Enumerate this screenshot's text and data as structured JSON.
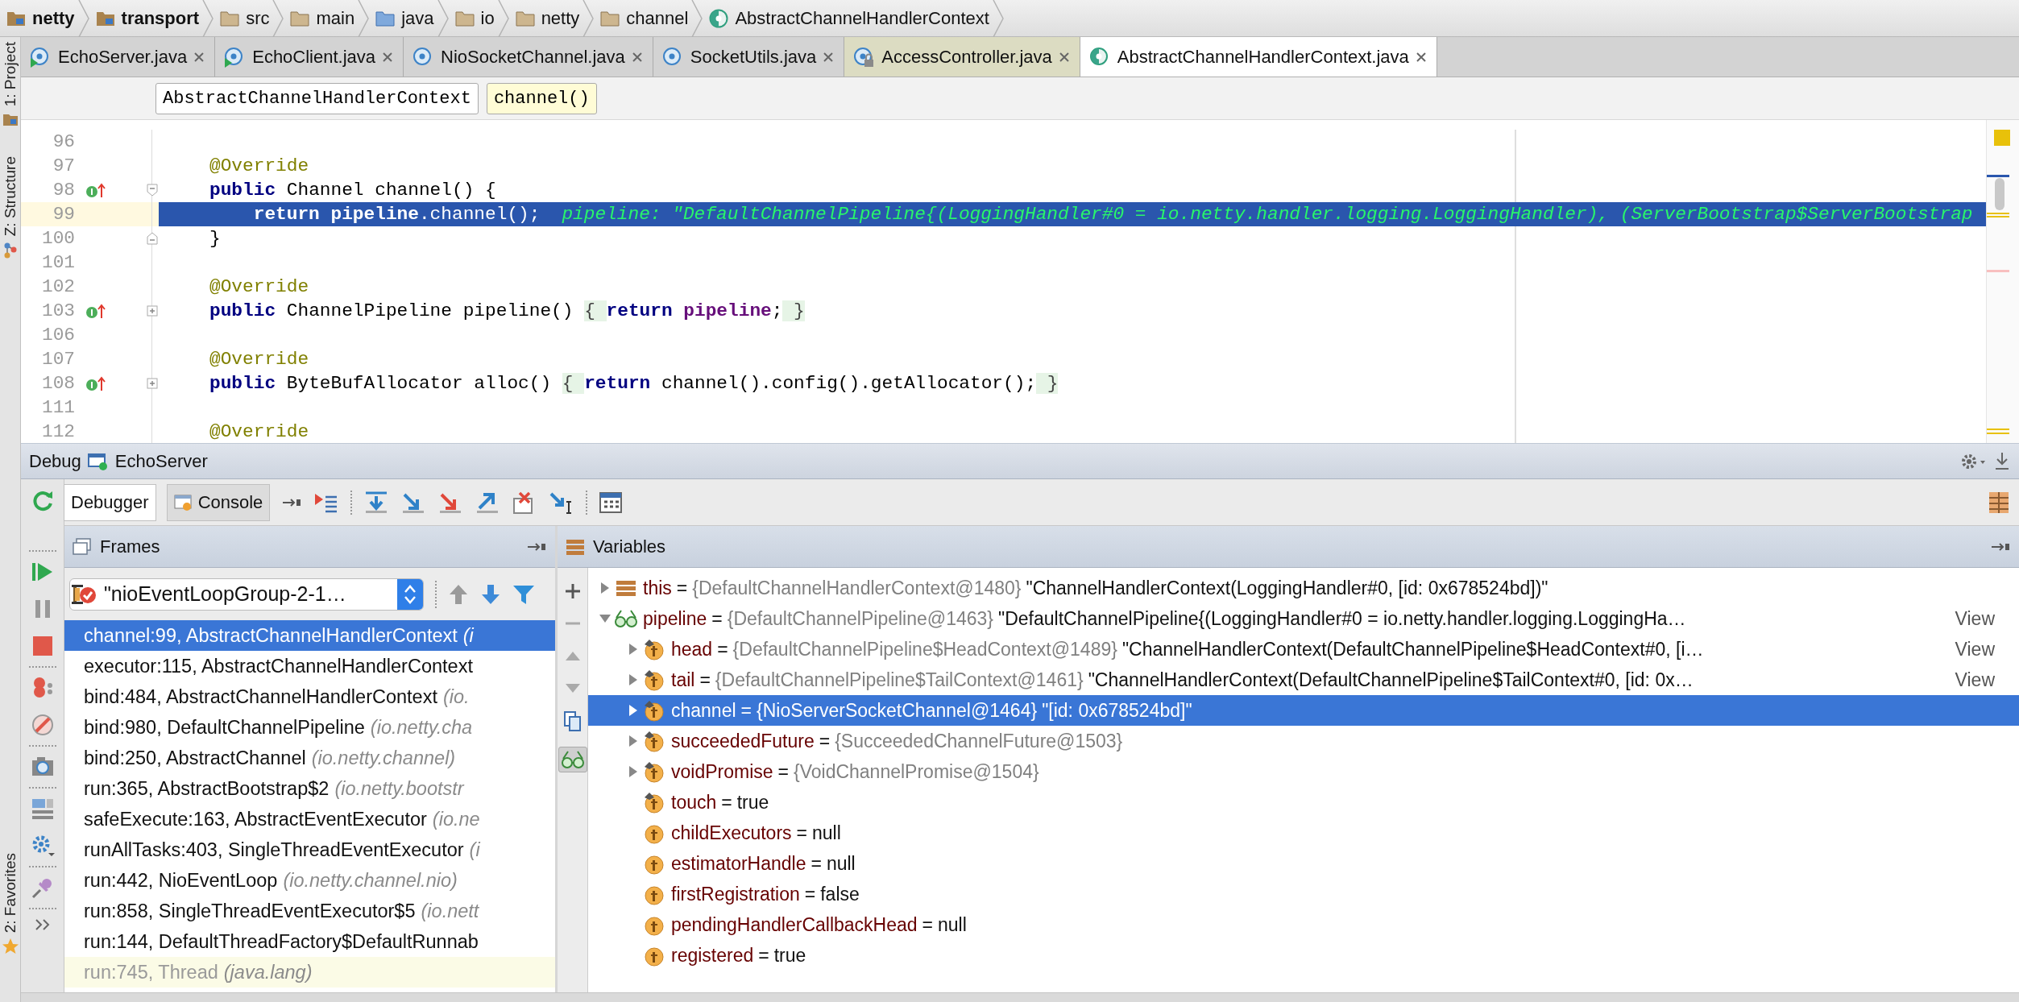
{
  "breadcrumbs": [
    {
      "label": "netty",
      "kind": "module"
    },
    {
      "label": "transport",
      "kind": "module"
    },
    {
      "label": "src",
      "kind": "folder"
    },
    {
      "label": "main",
      "kind": "folder"
    },
    {
      "label": "java",
      "kind": "source"
    },
    {
      "label": "io",
      "kind": "folder"
    },
    {
      "label": "netty",
      "kind": "folder"
    },
    {
      "label": "channel",
      "kind": "folder"
    },
    {
      "label": "AbstractChannelHandlerContext",
      "kind": "class"
    }
  ],
  "tool_windows": [
    {
      "label": "1: Project",
      "kind": "project"
    },
    {
      "label": "Z: Structure",
      "kind": "structure"
    },
    {
      "label": "2: Favorites",
      "kind": "favorites"
    }
  ],
  "tabs": [
    {
      "label": "EchoServer.java",
      "kind": "runnable",
      "selected": false
    },
    {
      "label": "EchoClient.java",
      "kind": "runnable",
      "selected": false
    },
    {
      "label": "NioSocketChannel.java",
      "kind": "class",
      "selected": false
    },
    {
      "label": "SocketUtils.java",
      "kind": "class",
      "selected": false
    },
    {
      "label": "AccessController.java",
      "kind": "library",
      "selected": false
    },
    {
      "label": "AbstractChannelHandlerContext.java",
      "kind": "abstract",
      "selected": true
    }
  ],
  "navigation": [
    {
      "label": "AbstractChannelHandlerContext",
      "selected": false
    },
    {
      "label": "channel()",
      "selected": true
    }
  ],
  "editor": {
    "lines": [
      {
        "number": "96",
        "selected": false
      },
      {
        "number": "97",
        "selected": false,
        "tokens": [
          {
            "kind": "annotation",
            "text": "@Override"
          }
        ]
      },
      {
        "number": "98",
        "selected": false,
        "gutter_marker": true,
        "fold_start": true,
        "tokens": [
          {
            "kind": "keyword",
            "text": "public"
          },
          {
            "kind": "plain",
            "text": " Channel channel() {"
          }
        ]
      },
      {
        "number": "99",
        "selected": true,
        "indented": true,
        "tokens": [
          {
            "kind": "keyword",
            "text": "return"
          },
          {
            "kind": "field",
            "text": " pipeline"
          },
          {
            "kind": "plain",
            "text": ".channel();"
          },
          {
            "kind": "hint",
            "text": "pipeline: \"DefaultChannelPipeline{(LoggingHandler#0 = io.netty.handler.logging.LoggingHandler), (ServerBootstrap$ServerBootstrap"
          }
        ]
      },
      {
        "number": "100",
        "selected": false,
        "fold_end": true,
        "tokens": [
          {
            "kind": "plain",
            "text": "}"
          }
        ]
      },
      {
        "number": "101",
        "selected": false
      },
      {
        "number": "102",
        "selected": false,
        "tokens": [
          {
            "kind": "annotation",
            "text": "@Override"
          }
        ]
      },
      {
        "number": "103",
        "selected": false,
        "gutter_marker": true,
        "collapsed": true,
        "tokens": [
          {
            "kind": "keyword",
            "text": "public"
          },
          {
            "kind": "plain",
            "text": " ChannelPipeline pipeline() "
          },
          {
            "kind": "folded",
            "text": "{ "
          },
          {
            "kind": "keyword",
            "text": "return"
          },
          {
            "kind": "field",
            "text": " pipeline"
          },
          {
            "kind": "plain",
            "text": ";"
          },
          {
            "kind": "folded",
            "text": " }"
          }
        ]
      },
      {
        "number": "106",
        "selected": false
      },
      {
        "number": "107",
        "selected": false,
        "tokens": [
          {
            "kind": "annotation",
            "text": "@Override"
          }
        ]
      },
      {
        "number": "108",
        "selected": false,
        "gutter_marker": true,
        "collapsed": true,
        "tokens": [
          {
            "kind": "keyword",
            "text": "public"
          },
          {
            "kind": "plain",
            "text": " ByteBufAllocator alloc() "
          },
          {
            "kind": "folded",
            "text": "{ "
          },
          {
            "kind": "keyword",
            "text": "return"
          },
          {
            "kind": "plain",
            "text": " channel().config().getAllocator();"
          },
          {
            "kind": "folded",
            "text": " }"
          }
        ]
      },
      {
        "number": "111",
        "selected": false
      },
      {
        "number": "112",
        "selected": false,
        "tokens": [
          {
            "kind": "annotation",
            "text": "@Override"
          }
        ]
      }
    ]
  },
  "debug": {
    "title": "Debug",
    "session": "EchoServer",
    "tabs": [
      {
        "label": "Debugger",
        "kind": "debugger",
        "selected": true
      },
      {
        "label": "Console",
        "kind": "console",
        "selected": false
      }
    ],
    "frames": {
      "title": "Frames",
      "thread": "\"nioEventLoopGroup-2-1…",
      "items": [
        {
          "method": "channel:99, AbstractChannelHandlerContext",
          "package": "(i",
          "kind": "project",
          "selected": true
        },
        {
          "method": "executor:115, AbstractChannelHandlerContext",
          "kind": "project",
          "selected": false
        },
        {
          "method": "bind:484, AbstractChannelHandlerContext",
          "package": "(io.",
          "kind": "project",
          "selected": false
        },
        {
          "method": "bind:980, DefaultChannelPipeline",
          "package": "(io.netty.cha",
          "kind": "project",
          "selected": false
        },
        {
          "method": "bind:250, AbstractChannel",
          "package": "(io.netty.channel)",
          "kind": "project",
          "selected": false
        },
        {
          "method": "run:365, AbstractBootstrap$2",
          "package": "(io.netty.bootstr",
          "kind": "project",
          "selected": false
        },
        {
          "method": "safeExecute:163, AbstractEventExecutor",
          "package": "(io.ne",
          "kind": "project",
          "selected": false
        },
        {
          "method": "runAllTasks:403, SingleThreadEventExecutor",
          "package": "(i",
          "kind": "project",
          "selected": false
        },
        {
          "method": "run:442, NioEventLoop",
          "package": "(io.netty.channel.nio)",
          "kind": "project",
          "selected": false
        },
        {
          "method": "run:858, SingleThreadEventExecutor$5",
          "package": "(io.nett",
          "kind": "project",
          "selected": false
        },
        {
          "method": "run:144, DefaultThreadFactory$DefaultRunnab",
          "kind": "project",
          "selected": false
        },
        {
          "method": "run:745, Thread",
          "package": "(java.lang)",
          "kind": "library",
          "selected": false
        }
      ]
    },
    "variables": {
      "title": "Variables",
      "items": [
        {
          "name": "this",
          "operator": "=",
          "type": "{DefaultChannelHandlerContext@1480}",
          "value": "\"ChannelHandlerContext(LoggingHandler#0, [id: 0x678524bd])\"",
          "kind": "object",
          "expanded": false,
          "selected": false
        },
        {
          "name": "pipeline",
          "operator": "=",
          "type": "{DefaultChannelPipeline@1463}",
          "value": "\"DefaultChannelPipeline{(LoggingHandler#0 = io.netty.handler.logging.LoggingHa…",
          "view": "View",
          "kind": "watch",
          "expanded": true,
          "selected": false,
          "children": [
            {
              "name": "head",
              "operator": "=",
              "type": "{DefaultChannelPipeline$HeadContext@1489}",
              "value": "\"ChannelHandlerContext(DefaultChannelPipeline$HeadContext#0, [i…",
              "view": "View",
              "kind": "final_field",
              "expanded": false,
              "selected": false
            },
            {
              "name": "tail",
              "operator": "=",
              "type": "{DefaultChannelPipeline$TailContext@1461}",
              "value": "\"ChannelHandlerContext(DefaultChannelPipeline$TailContext#0, [id: 0x…",
              "view": "View",
              "kind": "final_field",
              "expanded": false,
              "selected": false
            },
            {
              "name": "channel",
              "operator": "=",
              "type": "{NioServerSocketChannel@1464}",
              "value": "\"[id: 0x678524bd]\"",
              "kind": "final_field",
              "expanded": false,
              "selected": true
            },
            {
              "name": "succeededFuture",
              "operator": "=",
              "type": "{SucceededChannelFuture@1503}",
              "kind": "final_field",
              "expanded": false,
              "selected": false
            },
            {
              "name": "voidPromise",
              "operator": "=",
              "type": "{VoidChannelPromise@1504}",
              "kind": "final_field",
              "expanded": false,
              "selected": false
            },
            {
              "name": "touch",
              "operator": "=",
              "value": "true",
              "kind": "final_field",
              "selected": false
            },
            {
              "name": "childExecutors",
              "operator": "=",
              "value": "null",
              "kind": "field",
              "selected": false
            },
            {
              "name": "estimatorHandle",
              "operator": "=",
              "value": "null",
              "kind": "field",
              "selected": false
            },
            {
              "name": "firstRegistration",
              "operator": "=",
              "value": "false",
              "kind": "field",
              "selected": false
            },
            {
              "name": "pendingHandlerCallbackHead",
              "operator": "=",
              "value": "null",
              "kind": "field",
              "selected": false
            },
            {
              "name": "registered",
              "operator": "=",
              "value": "true",
              "kind": "field",
              "selected": false
            }
          ]
        }
      ]
    }
  }
}
